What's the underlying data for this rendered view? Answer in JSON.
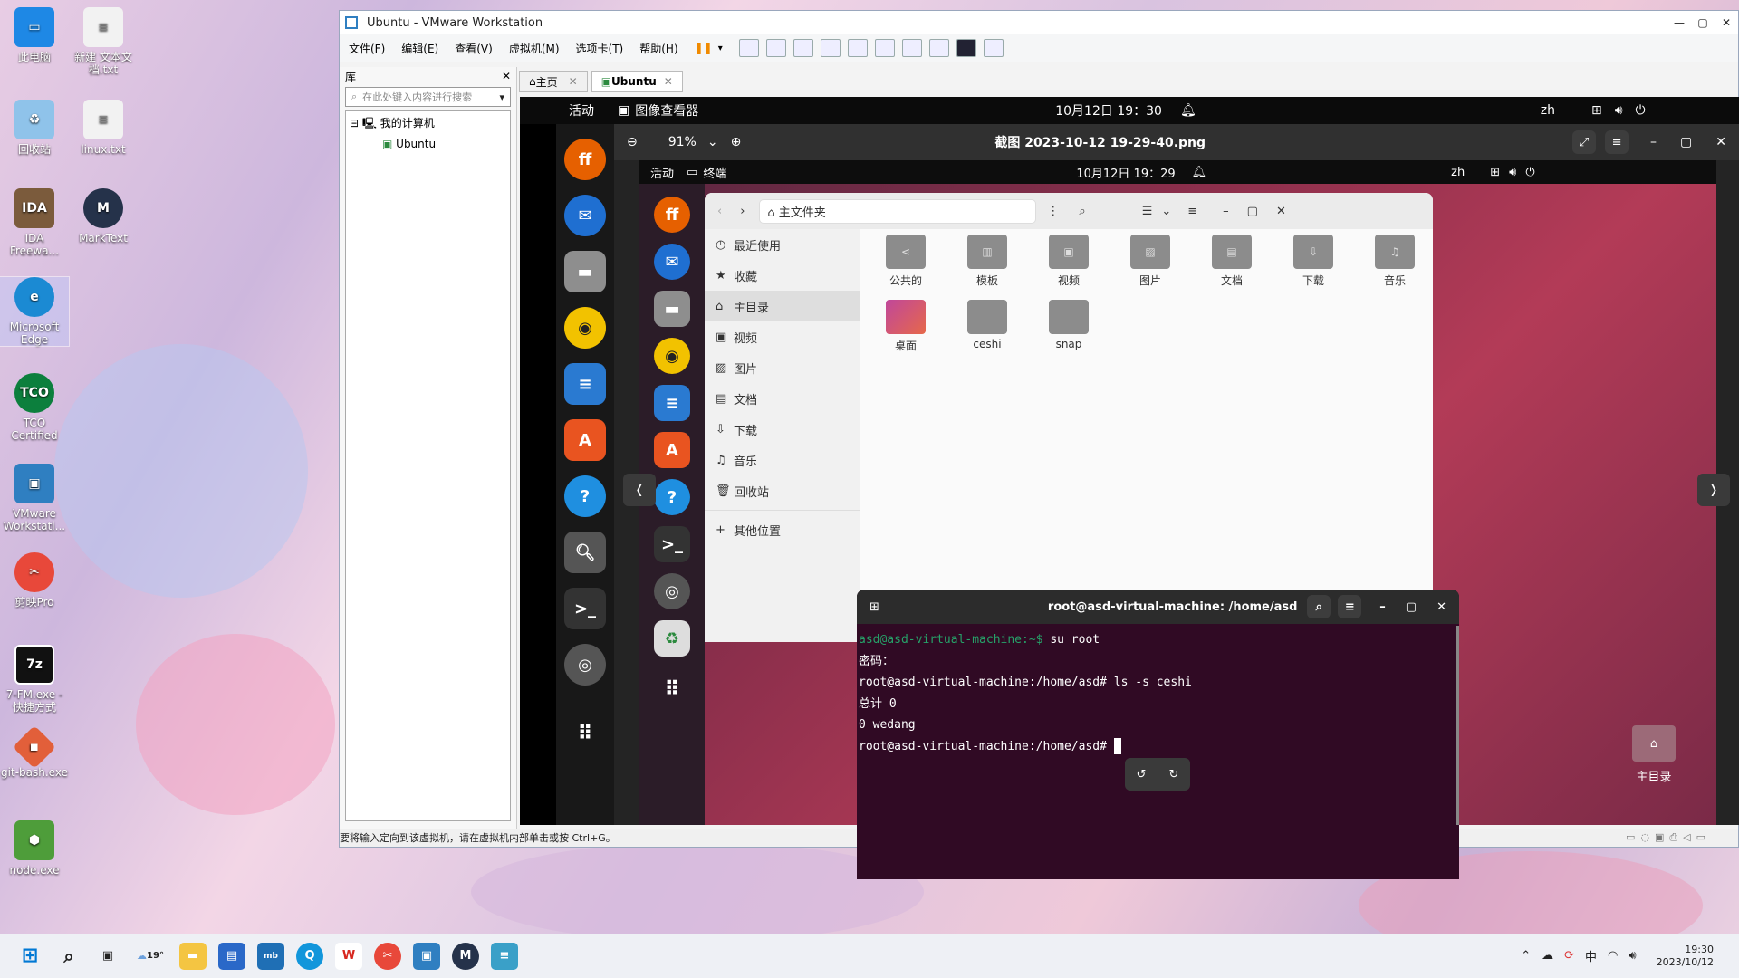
{
  "desktop": {
    "icons": [
      {
        "label": "此电脑",
        "icon": "computer-icon",
        "color": "#1e88e5"
      },
      {
        "label": "新建 文本文档.txt",
        "icon": "text-file-icon",
        "color": "#e0e0e0"
      },
      {
        "label": "回收站",
        "icon": "recycle-bin-icon",
        "color": "#4aa3df"
      },
      {
        "label": "linux.txt",
        "icon": "text-file-icon",
        "color": "#e0e0e0"
      },
      {
        "label": "IDA Freewa...",
        "icon": "ida-icon",
        "color": "#7b5b3c"
      },
      {
        "label": "MarkText",
        "icon": "marktext-icon",
        "color": "#25324a"
      },
      {
        "label": "Microsoft Edge",
        "icon": "edge-icon",
        "color": "#1b8ad3"
      },
      {
        "label": "TCO Certified",
        "icon": "tco-icon",
        "color": "#0c7f3d"
      },
      {
        "label": "VMware Workstati...",
        "icon": "vmware-icon",
        "color": "#2f7fc1"
      },
      {
        "label": "剪映Pro",
        "icon": "jianying-icon",
        "color": "#e8483a"
      },
      {
        "label": "7-FM.exe - 快捷方式",
        "icon": "7zip-icon",
        "color": "#111111"
      },
      {
        "label": "git-bash.exe",
        "icon": "git-icon",
        "color": "#e25f3a"
      },
      {
        "label": "node.exe",
        "icon": "node-icon",
        "color": "#4e9d3a"
      }
    ]
  },
  "vmware": {
    "title": "Ubuntu - VMware Workstation",
    "menus": [
      "文件(F)",
      "编辑(E)",
      "查看(V)",
      "虚拟机(M)",
      "选项卡(T)",
      "帮助(H)"
    ],
    "library": {
      "title": "库",
      "search_placeholder": "在此处键入内容进行搜索",
      "tree_root": "我的计算机",
      "tree_child": "Ubuntu"
    },
    "tabs": [
      {
        "label": "主页"
      },
      {
        "label": "Ubuntu"
      }
    ],
    "status": "要将输入定向到该虚拟机，请在虚拟机内部单击或按 Ctrl+G。"
  },
  "guest": {
    "activities": "活动",
    "app_name": "图像查看器",
    "clock": "10月12日 19：30",
    "lang": "zh",
    "viewer": {
      "zoom": "91%",
      "file_title": "截图 2023-10-12 19-29-40.png"
    },
    "inner": {
      "activities": "活动",
      "app_name": "终端",
      "clock": "10月12日 19：29",
      "lang": "zh",
      "files": {
        "location": "主文件夹",
        "sidebar": [
          "最近使用",
          "收藏",
          "主目录",
          "视频",
          "图片",
          "文档",
          "下载",
          "音乐",
          "回收站"
        ],
        "other": "其他位置",
        "folders": [
          "公共的",
          "模板",
          "视频",
          "图片",
          "文档",
          "下载",
          "音乐",
          "桌面",
          "ceshi",
          "snap"
        ]
      },
      "terminal": {
        "title": "root@asd-virtual-machine: /home/asd",
        "lines": [
          {
            "prompt": "asd@asd-virtual-machine:~$ ",
            "text": "su root"
          },
          {
            "prompt": "",
            "text": "密码："
          },
          {
            "prompt": "",
            "text": "root@asd-virtual-machine:/home/asd# ls -s ceshi"
          },
          {
            "prompt": "",
            "text": "总计 0"
          },
          {
            "prompt": "",
            "text": "0 wedang"
          },
          {
            "prompt": "",
            "text": "root@asd-virtual-machine:/home/asd# "
          }
        ]
      },
      "home_label": "主目录"
    }
  },
  "taskbar": {
    "weather": "19°",
    "ime": "中",
    "time": "19:30",
    "date": "2023/10/12"
  }
}
